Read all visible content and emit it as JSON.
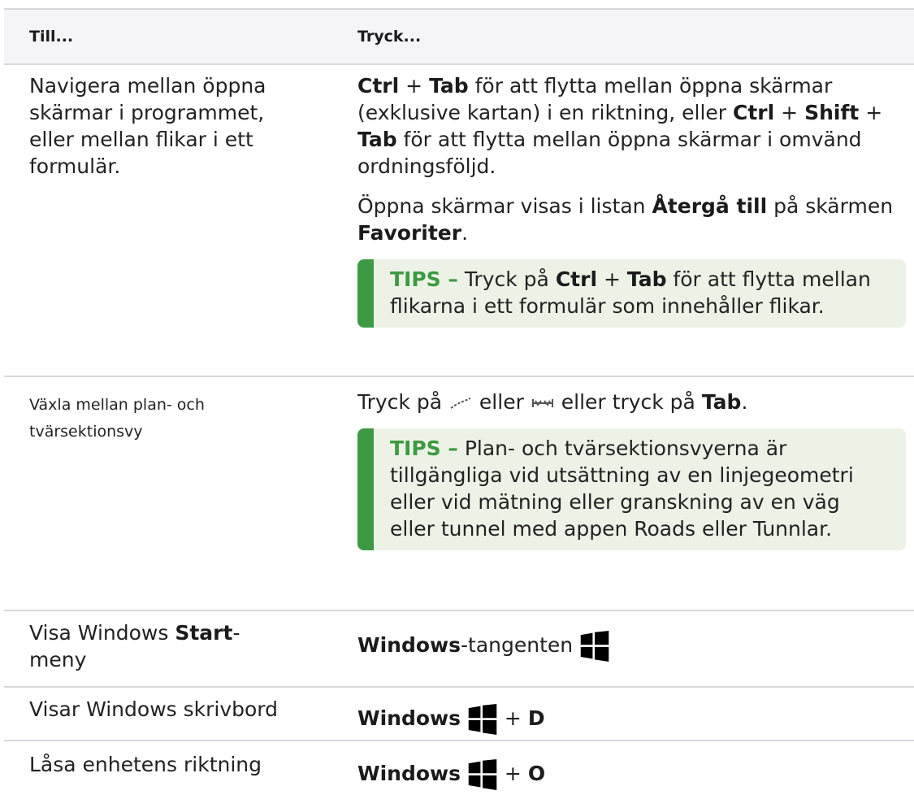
{
  "header": {
    "col1": "Till...",
    "col2": "Tryck..."
  },
  "rows": [
    {
      "col1": "Navigera mellan öppna skärmar i programmet, eller mellan flikar i ett formulär.",
      "p1": {
        "k1": "Ctrl",
        "plus": "+",
        "k2": "Tab",
        "t1": " för att flytta mellan öppna skärmar (exklusive kartan) i en riktning, eller ",
        "k3": "Ctrl",
        "k4": "Shift",
        "k5": "Tab",
        "t2": " för att flytta mellan öppna skärmar i omvänd ordningsföljd."
      },
      "p2": {
        "t1": "Öppna skärmar visas i listan ",
        "b1": "Återgå till",
        "t2": " på skärmen ",
        "b2": "Favoriter",
        "t3": "."
      },
      "tip": {
        "label": "TIPS –",
        "t1": " Tryck på ",
        "k1": "Ctrl",
        "k2": "Tab",
        "t2": " för att flytta mellan flikarna i ett formulär som innehåller flikar."
      }
    },
    {
      "col1": "Växla mellan plan- och tvärsektionsvy",
      "p1": {
        "t1": "Tryck på ",
        "t2": " eller ",
        "t3": " eller tryck på ",
        "b1": "Tab",
        "t4": "."
      },
      "tip": {
        "label": "TIPS –",
        "text": " Plan- och tvärsektionsvyerna är tillgängliga vid utsättning av en linjegeometri eller vid mätning eller granskning av en väg eller tunnel med appen Roads eller Tunnlar."
      }
    },
    {
      "col1_a": "Visa Windows ",
      "col1_b": "Start",
      "col1_c": "-meny",
      "b1": "Windows",
      "t1": "-tangenten"
    },
    {
      "col1": "Visar Windows skrivbord",
      "b1": "Windows",
      "k": "D"
    },
    {
      "col1": "Låsa enhetens riktning",
      "b1": "Windows",
      "k": "O"
    }
  ],
  "icons": [
    "plan-view-icon",
    "cross-section-icon",
    "windows-logo-icon"
  ],
  "colors": {
    "tip_accent": "#3d9a43",
    "tip_bg": "#ecf3e6",
    "header_bg": "#f5f5f7"
  }
}
